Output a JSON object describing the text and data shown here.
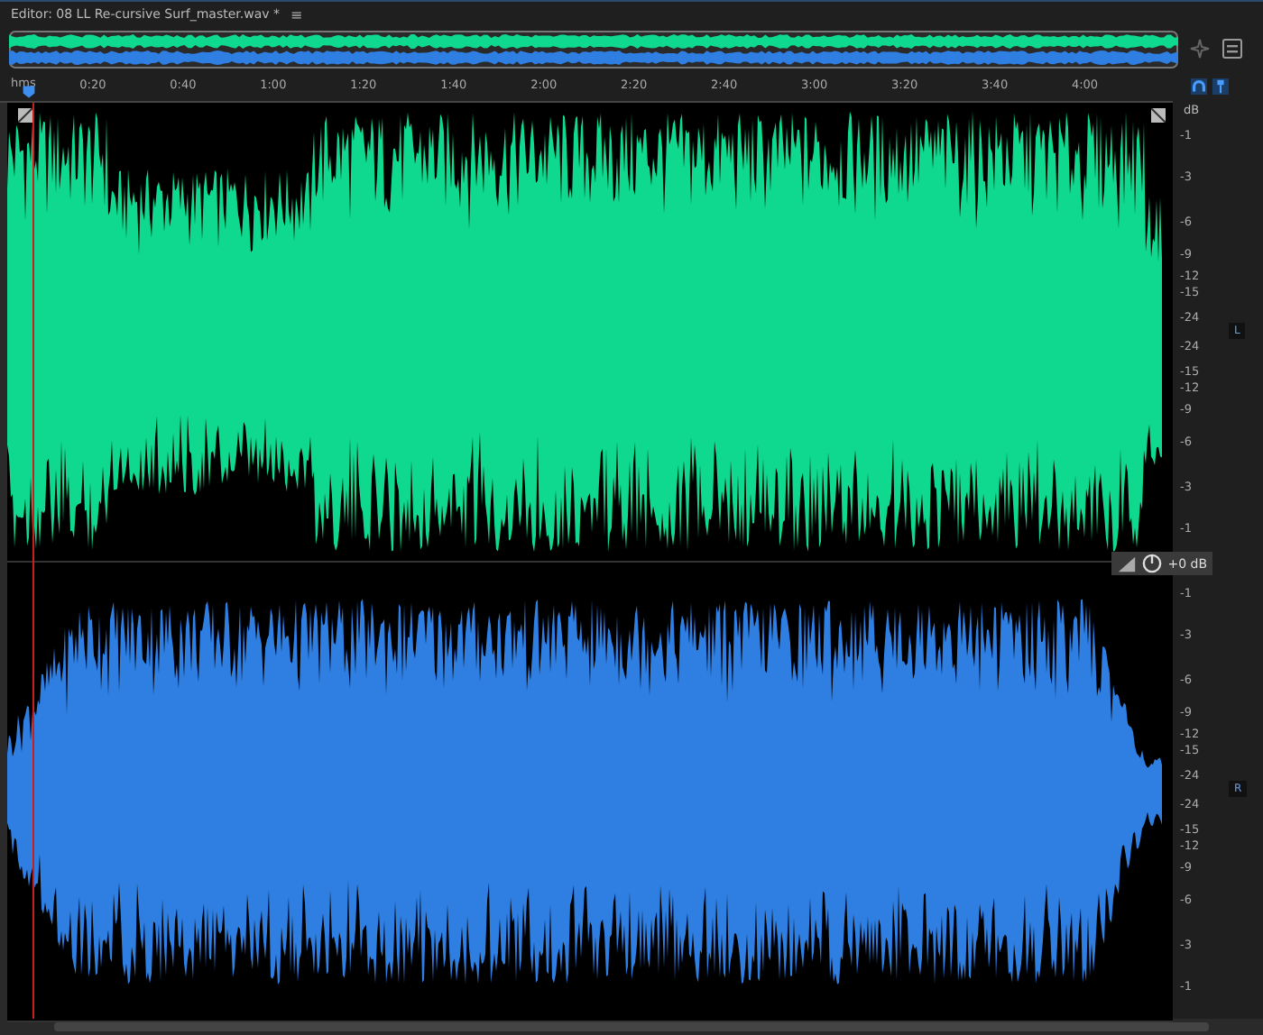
{
  "editor": {
    "title": "Editor: 08 LL Re-cursive Surf_master.wav *",
    "menu_icon": "≡"
  },
  "ruler": {
    "unit": "hms",
    "labels": [
      "0:20",
      "0:40",
      "1:00",
      "1:20",
      "1:40",
      "2:00",
      "2:20",
      "2:40",
      "3:00",
      "3:20",
      "3:40",
      "4:00"
    ]
  },
  "scale_unit": "dB",
  "channels": [
    {
      "name": "L",
      "color": "#0fd88f",
      "upper": [
        "-1",
        "-3",
        "-6",
        "-9",
        "-12",
        "-15",
        "-24"
      ],
      "lower": [
        "-24",
        "-15",
        "-12",
        "-9",
        "-6",
        "-3",
        "-1"
      ]
    },
    {
      "name": "R",
      "color": "#2f7fe3",
      "upper": [
        "-1",
        "-3",
        "-6",
        "-9",
        "-12",
        "-15",
        "-24"
      ],
      "lower": [
        "-24",
        "-15",
        "-12",
        "-9",
        "-6",
        "-3",
        "-1"
      ]
    }
  ],
  "gain": {
    "reading": "+0 dB"
  }
}
